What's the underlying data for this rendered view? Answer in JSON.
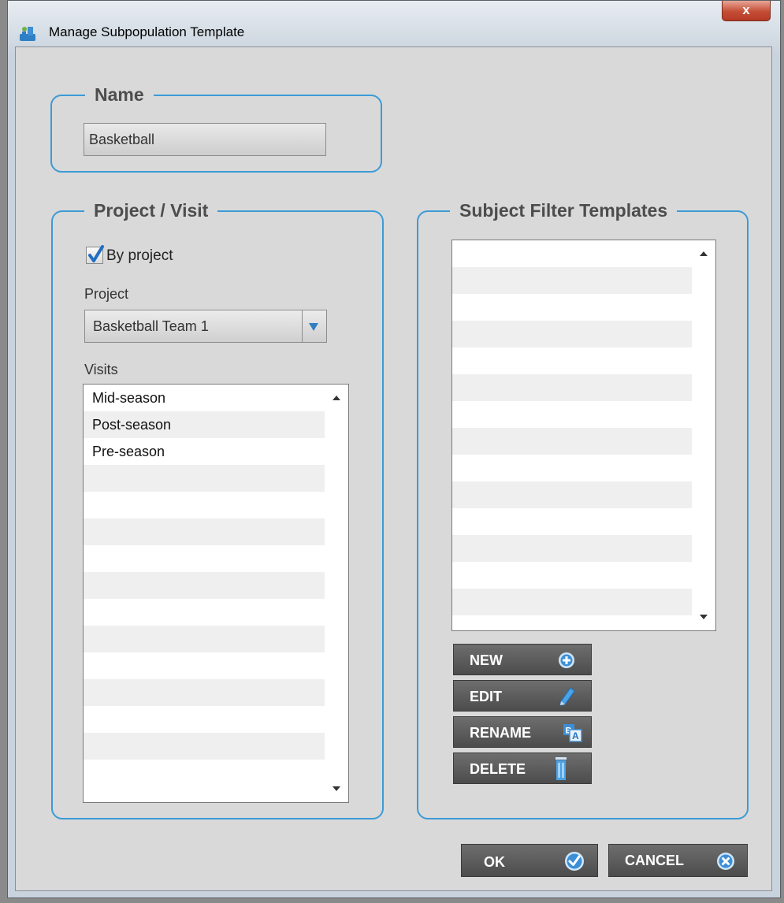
{
  "window": {
    "title": "Manage Subpopulation Template",
    "close_glyph": "x"
  },
  "name_group": {
    "legend": "Name",
    "value": "Basketball"
  },
  "project_group": {
    "legend": "Project / Visit",
    "by_project_label": "By project",
    "by_project_checked": true,
    "project_label": "Project",
    "project_value": "Basketball Team 1",
    "visits_label": "Visits",
    "visits": [
      "Mid-season",
      "Post-season",
      "Pre-season",
      "",
      "",
      "",
      "",
      "",
      "",
      "",
      "",
      "",
      "",
      "",
      ""
    ]
  },
  "filter_group": {
    "legend": "Subject Filter Templates",
    "items": [
      "",
      "",
      "",
      "",
      "",
      "",
      "",
      "",
      "",
      "",
      "",
      "",
      "",
      "",
      ""
    ]
  },
  "buttons": {
    "new": "NEW",
    "edit": "EDIT",
    "rename": "RENAME",
    "delete": "DELETE",
    "ok": "OK",
    "cancel": "CANCEL"
  },
  "icons": {
    "new": "plus-circle-icon",
    "edit": "pencil-icon",
    "rename": "rename-icon",
    "delete": "trash-icon",
    "ok": "check-circle-icon",
    "cancel": "x-circle-icon",
    "app": "app-logo-icon"
  },
  "colors": {
    "accent": "#3c9bd6",
    "button_bg": "#5a5a5a",
    "panel_bg": "#d9d9d9"
  }
}
